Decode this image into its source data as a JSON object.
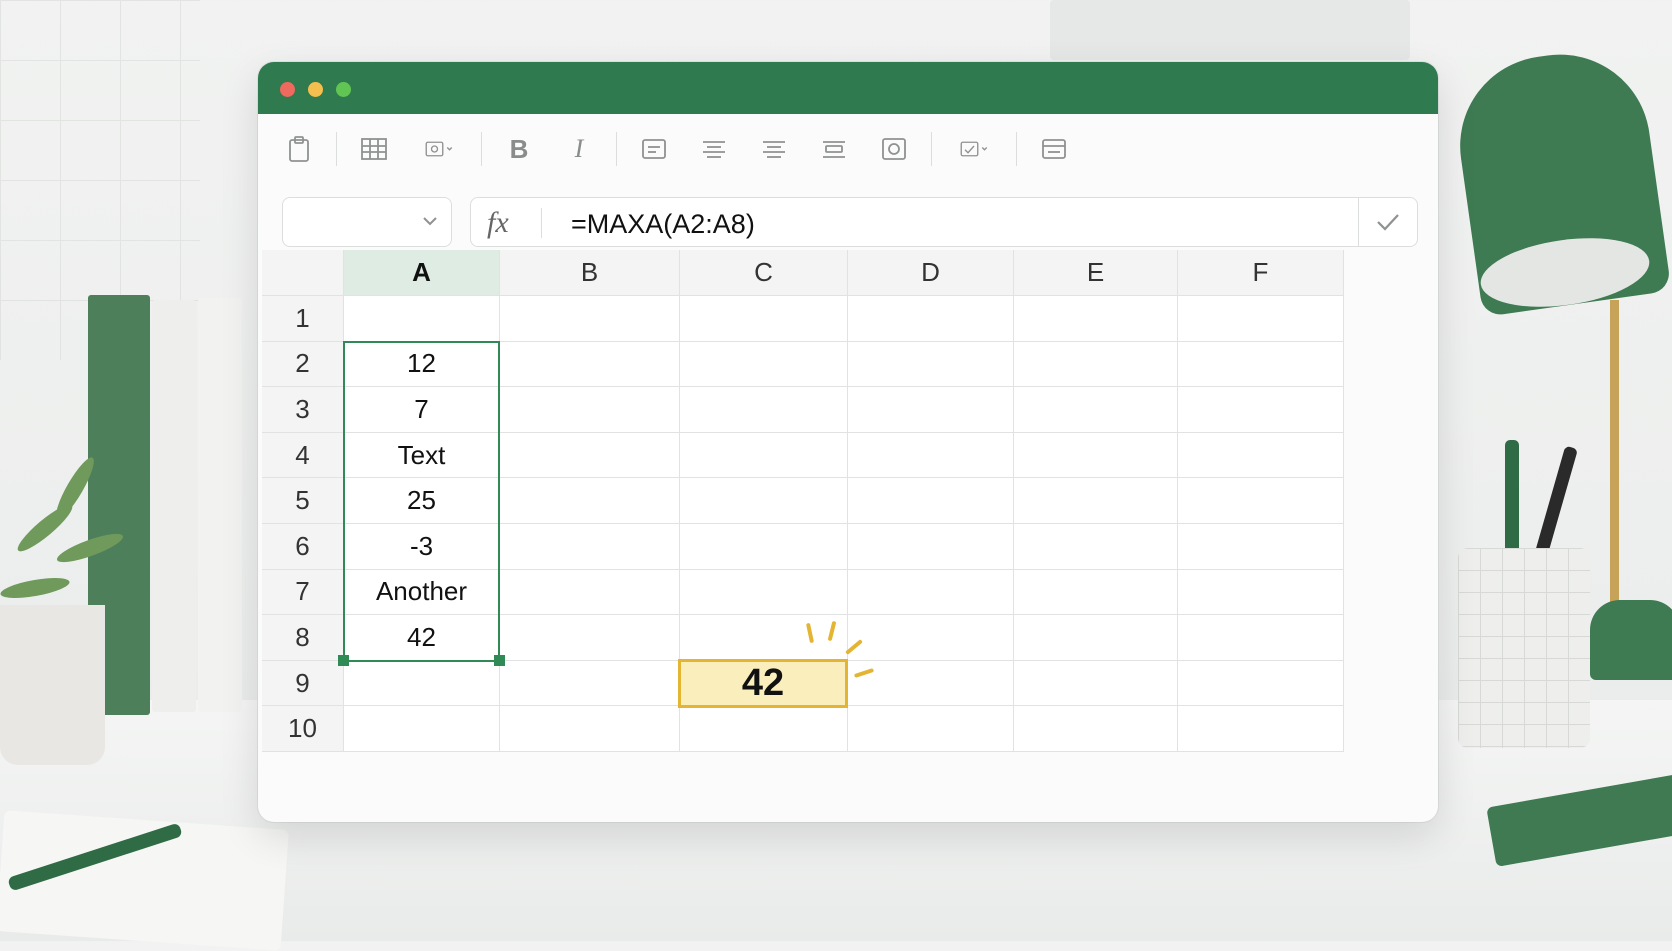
{
  "window": {
    "traffic_lights": [
      "close",
      "minimize",
      "zoom"
    ],
    "colors": {
      "titlebar": "#2f7a4e",
      "close": "#ee6a5e",
      "minimize": "#f5bf4f",
      "zoom": "#61c554",
      "selection": "#2f8a55",
      "result_fill": "#fbeebd",
      "result_border": "#e3b533"
    }
  },
  "toolbar": {
    "items": [
      {
        "icon": "clipboard-icon"
      },
      {
        "icon": "table-icon"
      },
      {
        "icon": "format-dropdown-icon"
      },
      {
        "icon": "bold-icon",
        "label": "B"
      },
      {
        "icon": "italic-icon",
        "label": "I"
      },
      {
        "icon": "align-left-icon"
      },
      {
        "icon": "align-center-icon"
      },
      {
        "icon": "align-right-icon"
      },
      {
        "icon": "wrap-text-icon"
      },
      {
        "icon": "chart-icon"
      },
      {
        "icon": "style-dropdown-icon"
      },
      {
        "icon": "merge-cells-icon"
      }
    ]
  },
  "formula_bar": {
    "name_box_value": "",
    "fx_label": "fx",
    "formula": "=MAXA(A2:A8)"
  },
  "grid": {
    "columns": [
      "A",
      "B",
      "C",
      "D",
      "E",
      "F"
    ],
    "selected_column": "A",
    "rows": [
      "1",
      "2",
      "3",
      "4",
      "5",
      "6",
      "7",
      "8",
      "9",
      "10"
    ],
    "column_a": [
      "",
      "12",
      "7",
      "Text",
      "25",
      "-3",
      "Another",
      "42",
      "",
      ""
    ],
    "selected_range": "A2:A8",
    "result_cell": "C9",
    "result_value": "42"
  }
}
